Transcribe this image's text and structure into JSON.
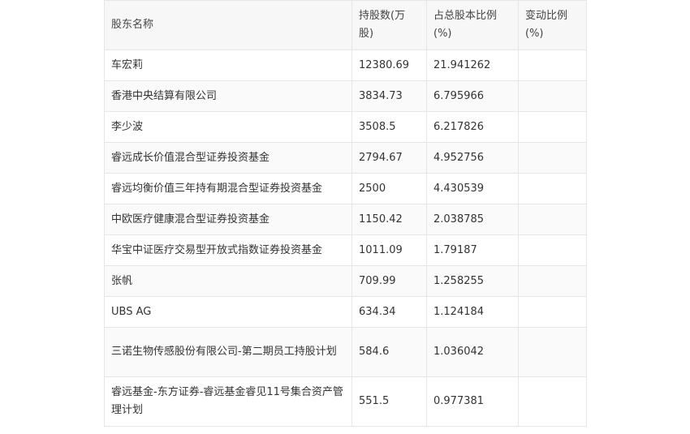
{
  "table": {
    "headers": [
      "股东名称",
      "持股数(万股)",
      "占总股本比例(%)",
      "变动比例(%)"
    ],
    "rows": [
      [
        "车宏莉",
        "12380.69",
        "21.941262",
        ""
      ],
      [
        "香港中央结算有限公司",
        "3834.73",
        "6.795966",
        ""
      ],
      [
        "李少波",
        "3508.5",
        "6.217826",
        ""
      ],
      [
        "睿远成长价值混合型证券投资基金",
        "2794.67",
        "4.952756",
        ""
      ],
      [
        "睿远均衡价值三年持有期混合型证券投资基金",
        "2500",
        "4.430539",
        ""
      ],
      [
        "中欧医疗健康混合型证券投资基金",
        "1150.42",
        "2.038785",
        ""
      ],
      [
        "华宝中证医疗交易型开放式指数证券投资基金",
        "1011.09",
        "1.79187",
        ""
      ],
      [
        "张帆",
        "709.99",
        "1.258255",
        ""
      ],
      [
        "UBS AG",
        "634.34",
        "1.124184",
        ""
      ],
      [
        "三诺生物传感股份有限公司-第二期员工持股计划",
        "584.6",
        "1.036042",
        ""
      ],
      [
        "睿远基金-东方证券-睿远基金睿见11号集合资产管理计划",
        "551.5",
        "0.977381",
        ""
      ]
    ]
  }
}
